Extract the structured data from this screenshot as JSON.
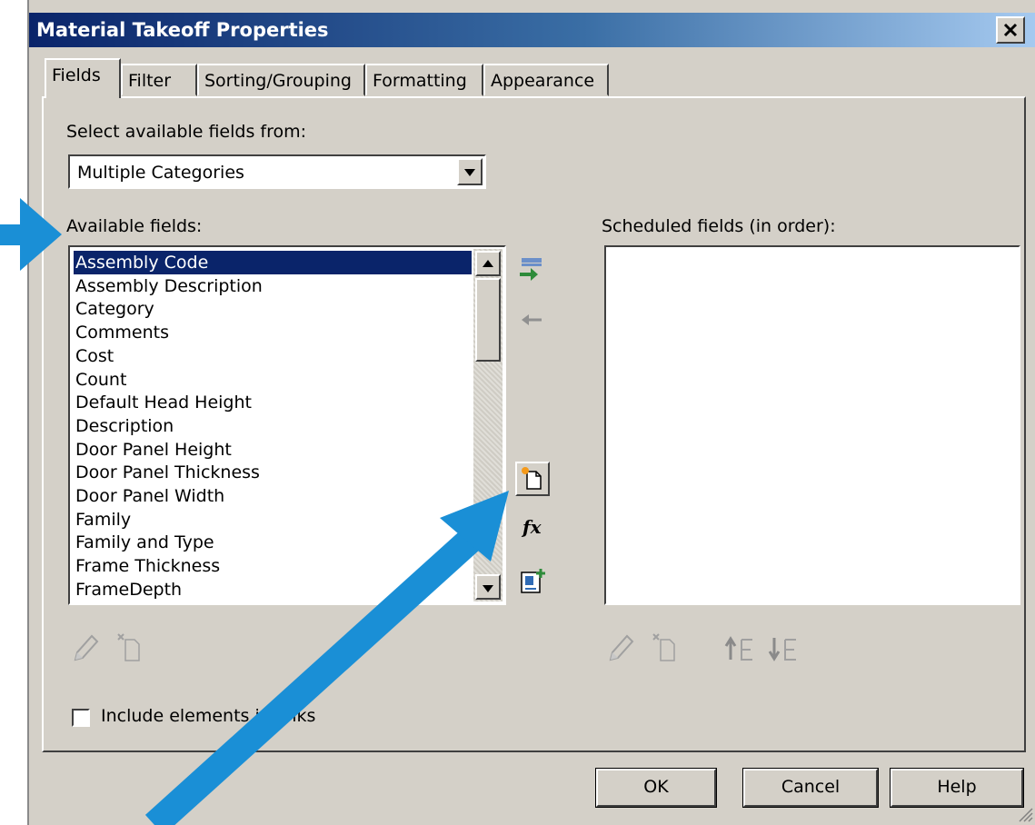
{
  "window": {
    "title": "Material Takeoff Properties",
    "close_label": "✕"
  },
  "tabs": [
    {
      "label": "Fields",
      "active": true
    },
    {
      "label": "Filter"
    },
    {
      "label": "Sorting/Grouping"
    },
    {
      "label": "Formatting"
    },
    {
      "label": "Appearance"
    }
  ],
  "fields_tab": {
    "source_label": "Select available fields from:",
    "source_value": "Multiple Categories",
    "available_label": "Available fields:",
    "scheduled_label": "Scheduled fields (in order):",
    "available_fields": [
      "Assembly Code",
      "Assembly Description",
      "Category",
      "Comments",
      "Cost",
      "Count",
      "Default Head Height",
      "Description",
      "Door Panel Height",
      "Door Panel Thickness",
      "Door Panel Width",
      "Family",
      "Family and Type",
      "Frame Thickness",
      "FrameDepth"
    ],
    "selected_field": "Assembly Code",
    "include_links_label": "Include elements in links",
    "include_links_checked": false
  },
  "buttons": {
    "ok": "OK",
    "cancel": "Cancel",
    "help": "Help"
  },
  "annotation_color": "#1a8fd6"
}
